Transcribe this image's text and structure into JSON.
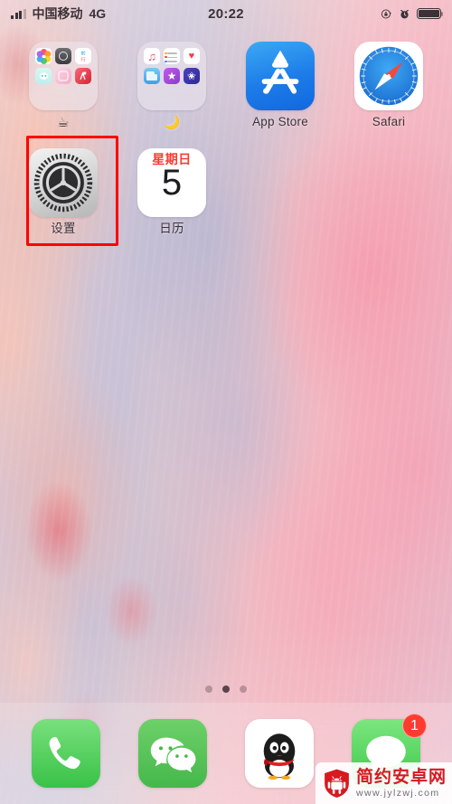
{
  "status_bar": {
    "carrier": "中国移动",
    "network": "4G",
    "time": "20:22",
    "icons": [
      "signal-bars-icon",
      "rotation-lock-icon",
      "alarm-clock-icon",
      "battery-icon"
    ],
    "battery_level": 100
  },
  "home_screen": {
    "rows": [
      {
        "apps": [
          {
            "name": "folder-photography",
            "type": "folder",
            "label": "☕",
            "mini_apps": [
              "photos",
              "camera",
              "white-text-app",
              "cyan-app",
              "instagram",
              "red-app"
            ]
          },
          {
            "name": "folder-media",
            "type": "folder",
            "label": "🌙",
            "mini_apps": [
              "music",
              "reminders",
              "health",
              "files",
              "purple-star-app",
              "blue-star-app"
            ]
          },
          {
            "name": "app-store",
            "type": "app",
            "label": "App Store",
            "icon": "appstore-icon"
          },
          {
            "name": "safari",
            "type": "app",
            "label": "Safari",
            "icon": "safari-compass-icon"
          }
        ]
      },
      {
        "apps": [
          {
            "name": "settings",
            "type": "app",
            "label": "设置",
            "icon": "gear-icon",
            "highlighted": true
          },
          {
            "name": "calendar",
            "type": "app",
            "label": "日历",
            "icon": "calendar-icon",
            "day_of_week": "星期日",
            "day_number": "5"
          }
        ]
      }
    ],
    "page_dots": {
      "count": 3,
      "active_index": 1
    }
  },
  "dock": {
    "apps": [
      {
        "name": "phone",
        "icon": "phone-handset-icon",
        "badge": null
      },
      {
        "name": "wechat",
        "icon": "wechat-bubbles-icon",
        "badge": null
      },
      {
        "name": "qq",
        "icon": "qq-penguin-icon",
        "badge": null
      },
      {
        "name": "messages",
        "icon": "message-bubble-icon",
        "badge": "1"
      }
    ]
  },
  "watermark": {
    "title": "简约安卓网",
    "url": "www.jylzwj.com",
    "logo": "android-shield-icon"
  },
  "colors": {
    "highlight": "#ff0000",
    "badge": "#ff3b30",
    "calendar_red": "#fb3b30",
    "watermark_red": "#d71920",
    "appstore_blue": "#1d7ce8",
    "dock_green": "#45b84a"
  }
}
